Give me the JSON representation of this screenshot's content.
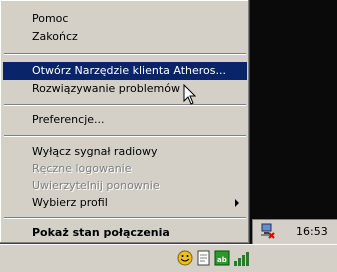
{
  "menu": {
    "items": [
      {
        "label": "Pomoc"
      },
      {
        "label": "Zakończ"
      },
      {
        "label": "Otwórz Narzędzie klienta Atheros..."
      },
      {
        "label": "Rozwiązywanie problemów"
      },
      {
        "label": "Preferencje..."
      },
      {
        "label": "Wyłącz sygnał radiowy"
      },
      {
        "label": "Ręczne logowanie"
      },
      {
        "label": "Uwierzytelnij ponownie"
      },
      {
        "label": "Wybierz profil"
      },
      {
        "label": "Pokaż stan połączenia"
      }
    ]
  },
  "tray": {
    "clock": "16:53"
  },
  "colors": {
    "menu_bg": "#d4d0c8",
    "highlight": "#0a246a",
    "disabled": "#808080",
    "desktop": "#0a0a0a"
  }
}
